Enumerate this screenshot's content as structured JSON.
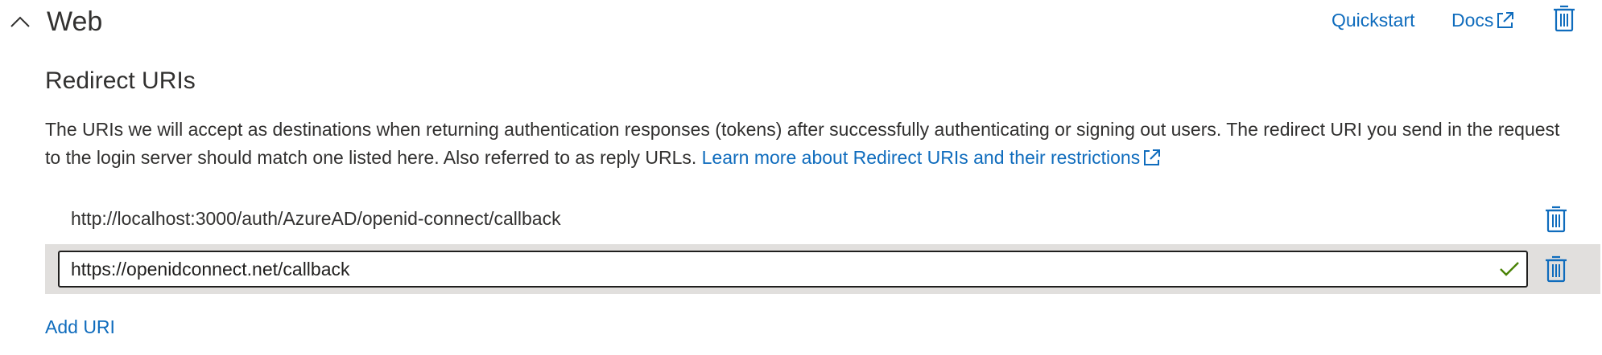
{
  "section": {
    "title": "Web",
    "collapse_icon": "chevron-up-icon",
    "quickstart_label": "Quickstart",
    "docs_label": "Docs",
    "delete_icon": "trash-icon"
  },
  "redirect_uris": {
    "title": "Redirect URIs",
    "description": "The URIs we will accept as destinations when returning authentication responses (tokens) after successfully authenticating or signing out users. The redirect URI you send in the request to the login server should match one listed here. Also referred to as reply URLs. ",
    "learn_more_label": "Learn more about Redirect URIs and their restrictions",
    "items": [
      {
        "value": "http://localhost:3000/auth/AzureAD/openid-connect/callback",
        "editing": false
      },
      {
        "value": "https://openidconnect.net/callback",
        "editing": true,
        "valid": true
      }
    ],
    "add_label": "Add URI"
  },
  "colors": {
    "link": "#0f6cbd",
    "text": "#323130",
    "valid_check": "#498205",
    "row_highlight": "#e1dfdd"
  }
}
